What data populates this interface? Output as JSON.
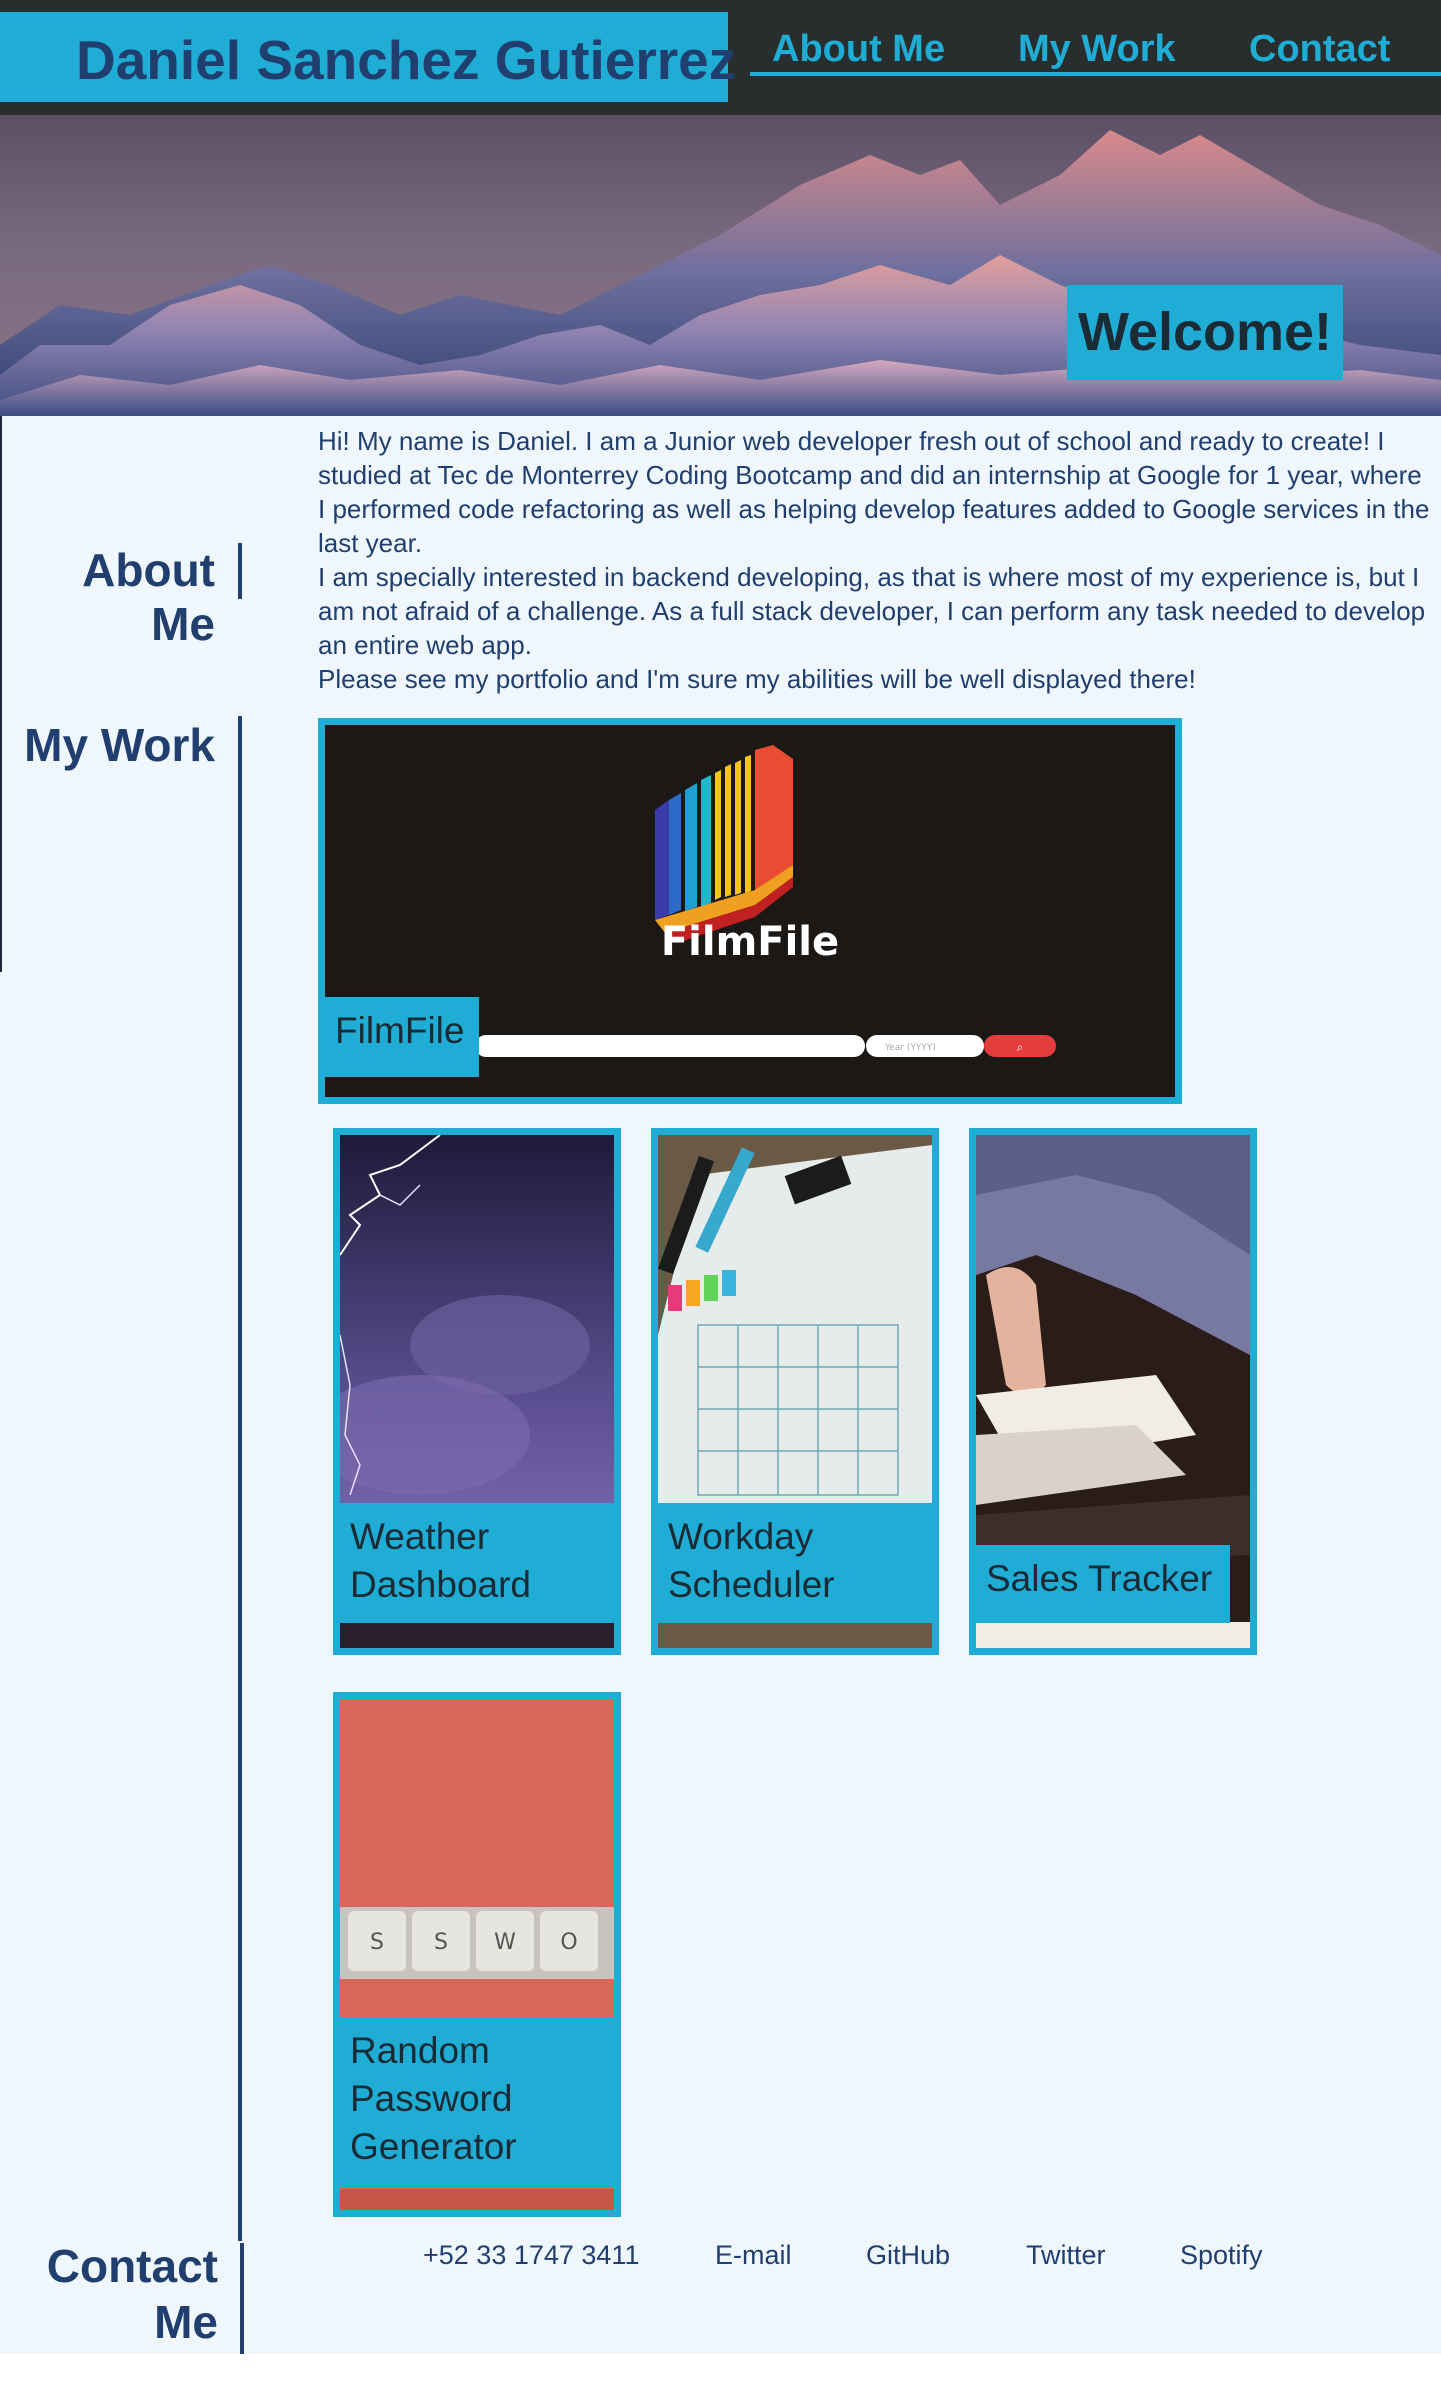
{
  "header": {
    "name": "Daniel Sanchez Gutierrez",
    "nav": [
      "About Me",
      "My Work",
      "Contact"
    ]
  },
  "hero": {
    "welcome": "Welcome!"
  },
  "about": {
    "title": "About Me",
    "paragraphs": [
      "Hi! My name is Daniel. I am a Junior web developer fresh out of school and ready to create! I studied at Tec de Monterrey Coding Bootcamp and did an internship at Google for 1 year, where I performed code refactoring as well as helping develop features added to Google services in the last year.",
      "I am specially interested in backend developing, as that is where most of my experience is, but I am not afraid of a challenge. As a full stack developer, I can perform any task needed to develop an entire web app.",
      "Please see my portfolio and I'm sure my abilities will be well displayed there!"
    ]
  },
  "work": {
    "title": "My Work",
    "featured": {
      "label": "FilmFile",
      "logo_text": "FilmFile",
      "search_placeholder": "Year (YYYY)",
      "search_icon": "search-icon"
    },
    "projects": [
      {
        "label": "Weather Dashboard",
        "image": "lightning-storm"
      },
      {
        "label": "Workday Scheduler",
        "image": "planner-calendar"
      },
      {
        "label": "Sales Tracker",
        "image": "hand-with-money"
      },
      {
        "label": "Random Password Generator",
        "image": "keyboard-keys"
      }
    ],
    "password_keys": [
      "S",
      "S",
      "W",
      "O"
    ]
  },
  "contact": {
    "title": "Contact Me",
    "links": [
      "+52 33 1747 3411",
      "E-mail",
      "GitHub",
      "Twitter",
      "Spotify"
    ]
  },
  "colors": {
    "accent": "#1fadd6",
    "navy": "#203e6e",
    "header_bg": "#282d2e",
    "main_bg": "#eff7fd"
  }
}
